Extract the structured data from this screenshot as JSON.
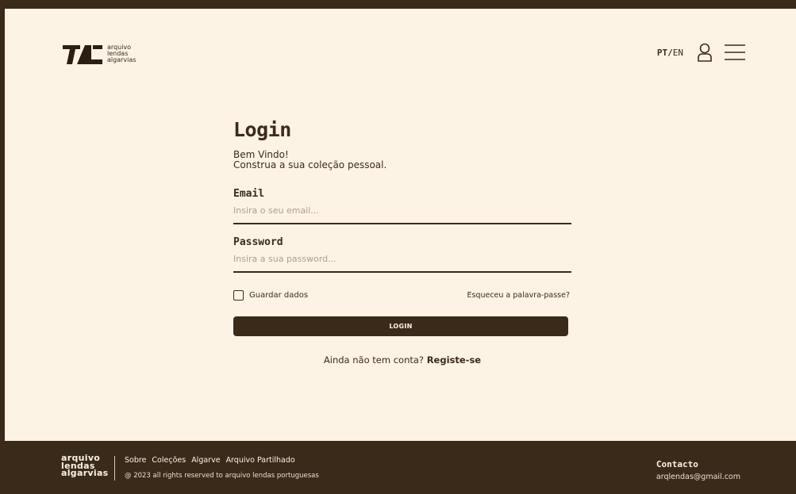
{
  "header": {
    "logo_lines": [
      "arquivo",
      "lendas",
      "algarvias"
    ],
    "lang_active": "PT",
    "lang_separator": "/",
    "lang_other": "EN",
    "icons": {
      "user": "user-icon",
      "menu": "hamburger-menu-icon"
    }
  },
  "form": {
    "title": "Login",
    "welcome_line1": "Bem Vindo!",
    "welcome_line2": "Construa a sua coleção pessoal.",
    "email_label": "Email",
    "email_placeholder": "Insira o seu email...",
    "email_value": "",
    "password_label": "Password",
    "password_placeholder": "Insira a sua password...",
    "password_value": "",
    "remember_label": "Guardar dados",
    "remember_checked": false,
    "forgot_label": "Esqueceu a palavra-passe?",
    "login_button": "LOGIN",
    "signup_prompt": "Ainda não tem conta?",
    "signup_link": "Registe-se"
  },
  "footer": {
    "logo_lines": [
      "arquivo",
      "lendas",
      "algarvias"
    ],
    "links": [
      "Sobre",
      "Coleções",
      "Algarve",
      "Arquivo Partilhado"
    ],
    "copyright": "@ 2023 all rights reserved to arquivo lendas portuguesas",
    "contact_title": "Contacto",
    "contact_email": "arqlendas@gmail.com"
  },
  "colors": {
    "background": "#fdf3e4",
    "dark": "#3a2a1a",
    "text": "#3a2b1c",
    "placeholder": "#a89f95"
  }
}
